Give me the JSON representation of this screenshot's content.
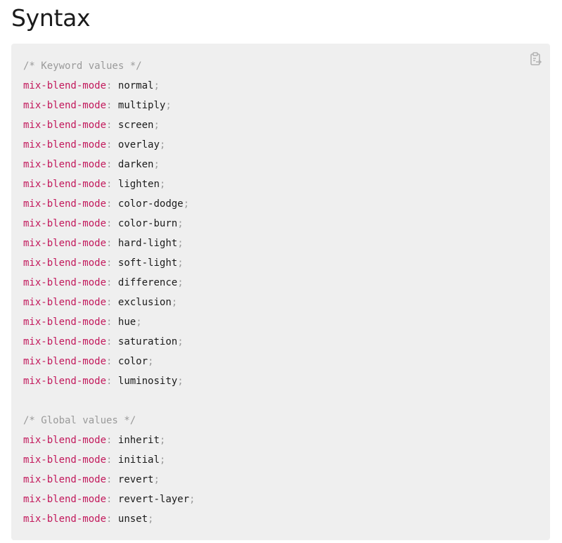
{
  "heading": "Syntax",
  "copy_icon": "clipboard-copy-icon",
  "colors": {
    "property": "#c2185b",
    "comment": "#9a9a9a",
    "text": "#1b1b1b",
    "code_background": "#efefef"
  },
  "code": {
    "comment_keyword": "/* Keyword values */",
    "comment_global": "/* Global values */",
    "property": "mix-blend-mode",
    "colon": ":",
    "semicolon": ";",
    "keyword_values": [
      "normal",
      "multiply",
      "screen",
      "overlay",
      "darken",
      "lighten",
      "color-dodge",
      "color-burn",
      "hard-light",
      "soft-light",
      "difference",
      "exclusion",
      "hue",
      "saturation",
      "color",
      "luminosity"
    ],
    "global_values": [
      "inherit",
      "initial",
      "revert",
      "revert-layer",
      "unset"
    ]
  }
}
